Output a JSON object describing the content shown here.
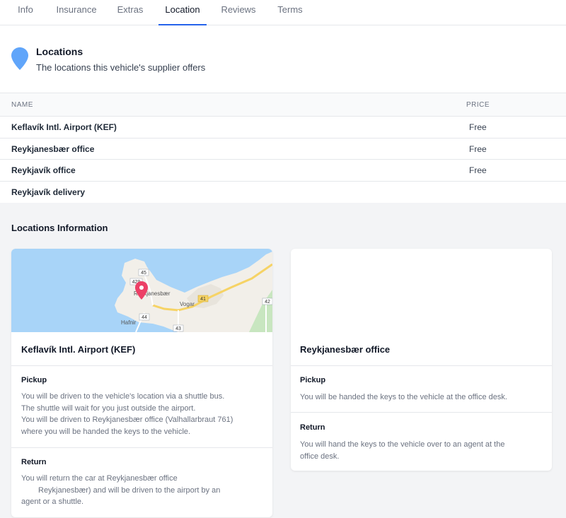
{
  "tabs": [
    {
      "label": "Info"
    },
    {
      "label": "Insurance"
    },
    {
      "label": "Extras"
    },
    {
      "label": "Location"
    },
    {
      "label": "Reviews"
    },
    {
      "label": "Terms"
    }
  ],
  "active_tab": "Location",
  "header": {
    "title": "Locations",
    "subtitle": "The locations this vehicle's supplier offers",
    "icon": "map-pin-icon",
    "icon_color": "#60a5fa"
  },
  "table": {
    "columns": {
      "name": "NAME",
      "price": "PRICE"
    },
    "rows": [
      {
        "name": "Keflavík Intl. Airport (KEF)",
        "price": "Free"
      },
      {
        "name": "Reykjanesbær office",
        "price": "Free"
      },
      {
        "name": "Reykjavík office",
        "price": "Free"
      },
      {
        "name": "Reykjavík delivery",
        "price": ""
      }
    ]
  },
  "info_section": {
    "title": "Locations Information"
  },
  "cards": [
    {
      "name": "Keflavík Intl. Airport (KEF)",
      "map": {
        "labels": [
          "Reykjanesbær",
          "Vogar",
          "Hafnir"
        ],
        "roads": [
          "45",
          "429",
          "44",
          "41",
          "43",
          "42"
        ],
        "marker_color": "#ec4066"
      },
      "pickup_label": "Pickup",
      "pickup_lines": [
        "You will be driven to the vehicle's location via a shuttle bus.",
        "The shuttle will wait for you just outside the airport.",
        "You will be driven to Reykjanesbær office (Valhallarbraut 761)",
        "where you will be handed the keys to the vehicle."
      ],
      "return_label": "Return",
      "return_lines": [
        "You will return the car at Reykjanesbær office",
        "Reykjanesbær) and will be driven to the airport by an",
        "agent or a shuttle."
      ]
    },
    {
      "name": "Reykjanesbær office",
      "pickup_label": "Pickup",
      "pickup_lines": [
        "You will be handed the keys to the vehicle at the office desk."
      ],
      "return_label": "Return",
      "return_lines": [
        "You will hand the keys to the vehicle over to an agent at the",
        "office desk."
      ]
    }
  ]
}
